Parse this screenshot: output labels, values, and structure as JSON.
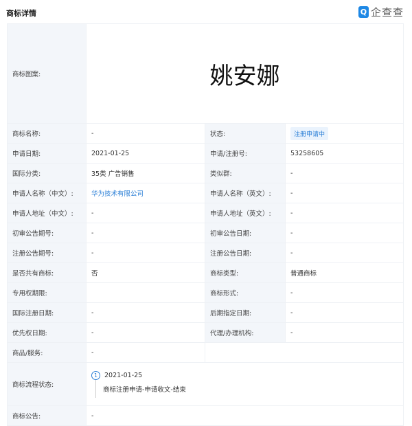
{
  "header": {
    "title": "商标详情",
    "logo_text": "企查查"
  },
  "mark_label": "商标图案:",
  "mark_text": "姚安娜",
  "rows": [
    [
      "商标名称:",
      "-",
      "状态:",
      "注册申请中"
    ],
    [
      "申请日期:",
      "2021-01-25",
      "申请/注册号:",
      "53258605"
    ],
    [
      "国际分类:",
      "35类 广告销售",
      "类似群:",
      "-"
    ],
    [
      "申请人名称（中文）:",
      "华为技术有限公司",
      "申请人名称（英文）:",
      "-"
    ],
    [
      "申请人地址（中文）:",
      "-",
      "申请人地址（英文）:",
      "-"
    ],
    [
      "初审公告期号:",
      "-",
      "初审公告日期:",
      "-"
    ],
    [
      "注册公告期号:",
      "-",
      "注册公告日期:",
      "-"
    ],
    [
      "是否共有商标:",
      "否",
      "商标类型:",
      "普通商标"
    ],
    [
      "专用权期限:",
      "",
      "商标形式:",
      "-"
    ],
    [
      "国际注册日期:",
      "-",
      "后期指定日期:",
      "-"
    ],
    [
      "优先权日期:",
      "-",
      "代理/办理机构:",
      "-"
    ]
  ],
  "goods": {
    "label": "商品/服务:",
    "value": "-"
  },
  "flow": {
    "label": "商标流程状态:",
    "step": "1",
    "date": "2021-01-25",
    "desc": "商标注册申请-申请收文-结束"
  },
  "notice": {
    "label": "商标公告:",
    "value": "-"
  }
}
